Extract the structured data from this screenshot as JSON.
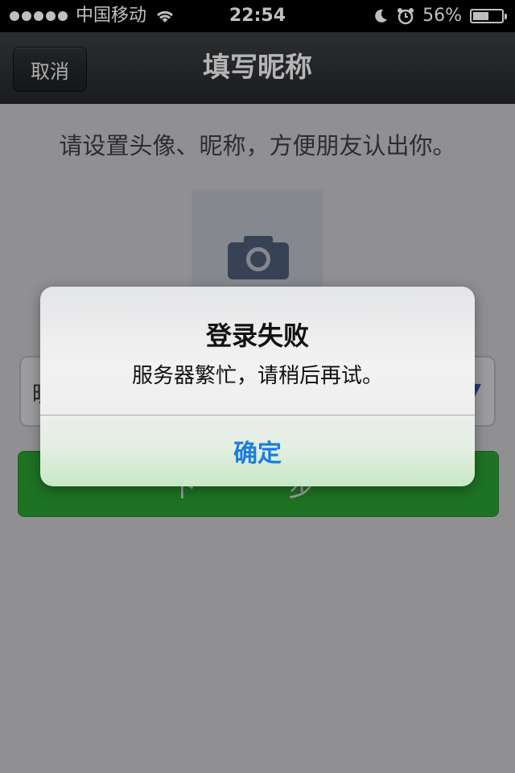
{
  "status_bar": {
    "carrier": "中国移动",
    "time": "22:54",
    "battery_text": "56%",
    "battery_level": 0.56,
    "icons": [
      "signal-dots-icon",
      "wifi-icon",
      "moon-icon",
      "alarm-icon",
      "battery-icon"
    ]
  },
  "nav": {
    "cancel_label": "取消",
    "title": "填写昵称"
  },
  "content": {
    "hint": "请设置头像、昵称，方便朋友认出你。",
    "avatar_icon": "camera-icon",
    "nickname_label_fragment": "昵",
    "next_button_label": "下一步"
  },
  "alert": {
    "title": "登录失败",
    "message": "服务器繁忙，请稍后再试。",
    "confirm_label": "确定"
  },
  "colors": {
    "accent_green": "#17b21c",
    "alert_button_blue": "#1a7de0",
    "nav_dark": "#23262a"
  }
}
